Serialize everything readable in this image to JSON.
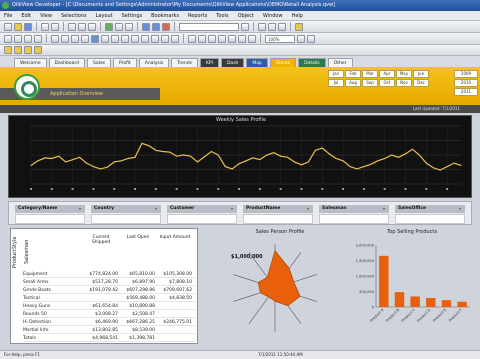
{
  "window": {
    "title": "QlikView Developer - [C:\\Documents and Settings\\Administrator\\My Documents\\QlikView Applications\\DEMO\\Retail Analysis.qvw]"
  },
  "menubar": {
    "items": [
      "File",
      "Edit",
      "View",
      "Selections",
      "Layout",
      "Settings",
      "Bookmarks",
      "Reports",
      "Tools",
      "Object",
      "Window",
      "Help"
    ]
  },
  "toolbar": {
    "search_placeholder": "",
    "zoom_value": "100%"
  },
  "sheet_tabs": [
    {
      "label": "Welcome",
      "style": "light"
    },
    {
      "label": "Dashboard",
      "style": "light"
    },
    {
      "label": "Sales",
      "style": "light"
    },
    {
      "label": "Profit",
      "style": "light"
    },
    {
      "label": "Analysis",
      "style": "light"
    },
    {
      "label": "Trends",
      "style": "light"
    },
    {
      "label": "KPI",
      "style": "dark"
    },
    {
      "label": "Dash",
      "style": "dark"
    },
    {
      "label": "Map",
      "style": "blue"
    },
    {
      "label": "Stores",
      "style": "active"
    },
    {
      "label": "Details",
      "style": "green"
    },
    {
      "label": "Other",
      "style": "light"
    }
  ],
  "header": {
    "app_name": "Application Overview",
    "last_update": "Last Updated: 7/1/2011"
  },
  "calendar": {
    "months": [
      "Jan",
      "Feb",
      "Mar",
      "Apr",
      "May",
      "Jun",
      "Jul",
      "Aug",
      "Sep",
      "Oct",
      "Nov",
      "Dec"
    ],
    "years": [
      "2009",
      "2010",
      "2011"
    ]
  },
  "trend_chart": {
    "title": "Weekly Sales Profile"
  },
  "chart_data": [
    {
      "type": "line",
      "title": "Weekly Sales Profile",
      "series": [
        {
          "values": [
            32,
            40,
            45,
            44,
            48,
            38,
            42,
            46,
            36,
            30,
            26,
            29,
            38,
            40,
            44,
            46,
            70,
            66,
            58,
            56,
            55,
            48,
            50,
            48,
            38,
            47,
            56,
            50,
            30,
            26,
            35,
            40,
            45,
            42,
            50,
            54,
            48,
            46,
            38,
            33,
            38,
            58,
            62,
            52,
            44,
            40,
            30,
            26,
            30,
            34,
            40,
            44,
            50,
            46,
            52,
            60,
            50,
            36,
            28,
            24,
            30,
            36,
            32
          ]
        }
      ],
      "ylim": [
        0,
        100
      ],
      "grid": true,
      "color": "#e8c14a"
    },
    {
      "type": "radar",
      "title": "Sales Person Profile",
      "annotation": "$1,000,000",
      "values": [
        0.85,
        0.55,
        0.45,
        0.6,
        0.5,
        0.3,
        0.25,
        0.35,
        0.4,
        0.3
      ],
      "color": "#e8600a"
    },
    {
      "type": "bar",
      "title": "Top Selling Products",
      "categories": [
        "Product A",
        "Product B",
        "Product C",
        "Product D",
        "Product E",
        "Product F"
      ],
      "values": [
        1650000,
        480000,
        340000,
        290000,
        220000,
        170000
      ],
      "ylim": [
        0,
        2000000
      ],
      "yticks": [
        "2,000,000",
        "1,500,000",
        "1,000,000",
        "500,000",
        "0"
      ],
      "color": "#e8600a"
    }
  ],
  "filters": [
    {
      "label": "Category/Name"
    },
    {
      "label": "Country"
    },
    {
      "label": "Customer"
    },
    {
      "label": "ProductName"
    },
    {
      "label": "Salesman"
    },
    {
      "label": "SalesOffice"
    }
  ],
  "pivot_table": {
    "dim1_label": "ProductStyle",
    "dim2_label": "Salesman",
    "columns": [
      "Current Shipped",
      "Last Open",
      "Input Amount"
    ],
    "rows": [
      [
        "Equipment",
        "$774,824.00",
        "$65,810.00",
        "$105,308.00"
      ],
      [
        "Small Arms",
        "$517,28.70",
        "$6,897.90",
        "$7,808.10"
      ],
      [
        "Grnde Boats",
        "$191,078.42",
        "$607,298.96",
        "$709,607.62"
      ],
      [
        "Tactical",
        "",
        "$569,488.00",
        "$4,838.50"
      ],
      [
        "Heavy Guns",
        "$61,654.84",
        "$10,890.88",
        ""
      ],
      [
        "Rounds 50",
        "$3,008.27",
        "$2,508.47",
        ""
      ],
      [
        "Hi Detection",
        "$6,469.90",
        "$667,286.25",
        "$246,775.01"
      ],
      [
        "Martial Info",
        "$13,802.85",
        "$8,539.00",
        ""
      ],
      [
        "Totals",
        "$4,968,541",
        "$1,398,781",
        ""
      ]
    ]
  },
  "status": {
    "left": "For Help, press F1",
    "right": "7/1/2011 11:50:44 AM"
  }
}
